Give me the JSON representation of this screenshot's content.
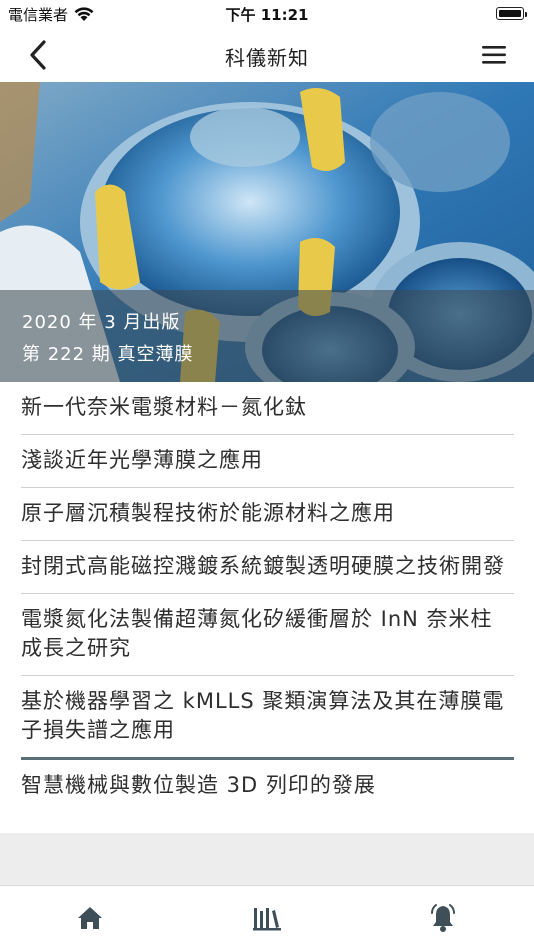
{
  "status_bar": {
    "carrier": "電信業者",
    "time": "下午 11:21"
  },
  "nav": {
    "title": "科儀新知",
    "back_icon": "chevron-left-icon",
    "menu_icon": "hamburger-menu-icon"
  },
  "hero": {
    "date": "2020 年 3 月出版",
    "issue": "第 222 期 真空薄膜"
  },
  "articles": [
    "新一代奈米電漿材料－氮化鈦",
    "淺談近年光學薄膜之應用",
    "原子層沉積製程技術於能源材料之應用",
    "封閉式高能磁控濺鍍系統鍍製透明硬膜之技術開發",
    "電漿氮化法製備超薄氮化矽緩衝層於 InN 奈米柱成長之研究",
    "基於機器學習之 kMLLS 聚類演算法及其在薄膜電子損失譜之應用",
    "智慧機械與數位製造 3D 列印的發展"
  ],
  "tab_bar": {
    "tabs": [
      "home-icon",
      "library-icon",
      "notification-bell-icon"
    ]
  },
  "colors": {
    "accent_divider": "#5a6f78",
    "caption_overlay": "#3c4850"
  }
}
